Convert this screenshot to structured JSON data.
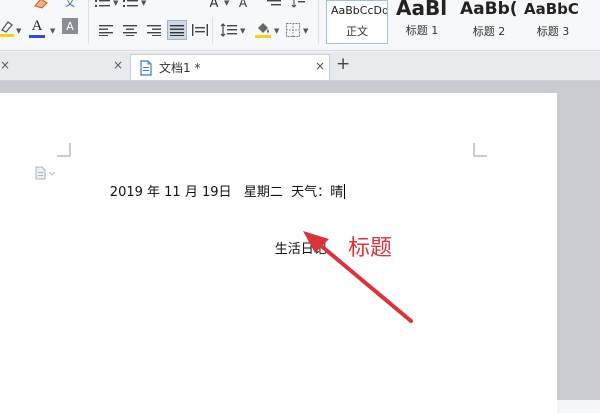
{
  "toolbar": {
    "font_color_glyph": "A",
    "text_effect_glyph": "A",
    "char_shading_glyph": "A",
    "phonetic_glyph": "文",
    "font_size_glyph": "A",
    "accent_yellow": "#f2d21b",
    "accent_blue": "#2d4fd0",
    "accent_red": "#d9343a",
    "align_justify_active": true
  },
  "style_gallery": {
    "items": [
      {
        "sample": "AaBbCcDd",
        "name": "正文"
      },
      {
        "sample": "AaBl",
        "name": "标题 1"
      },
      {
        "sample": "AaBb(",
        "name": "标题 2"
      },
      {
        "sample": "AaBbC",
        "name": "标题 3"
      }
    ]
  },
  "tabs": {
    "first_close": "×",
    "doc_title": "文档1 *",
    "doc_close": "×",
    "new_tab": "+"
  },
  "document": {
    "line1": "2019 年 11 月 19日   星期二  天气：晴",
    "line2": "生活日记"
  },
  "annotation": {
    "label": "标题",
    "color": "#d9343a"
  }
}
